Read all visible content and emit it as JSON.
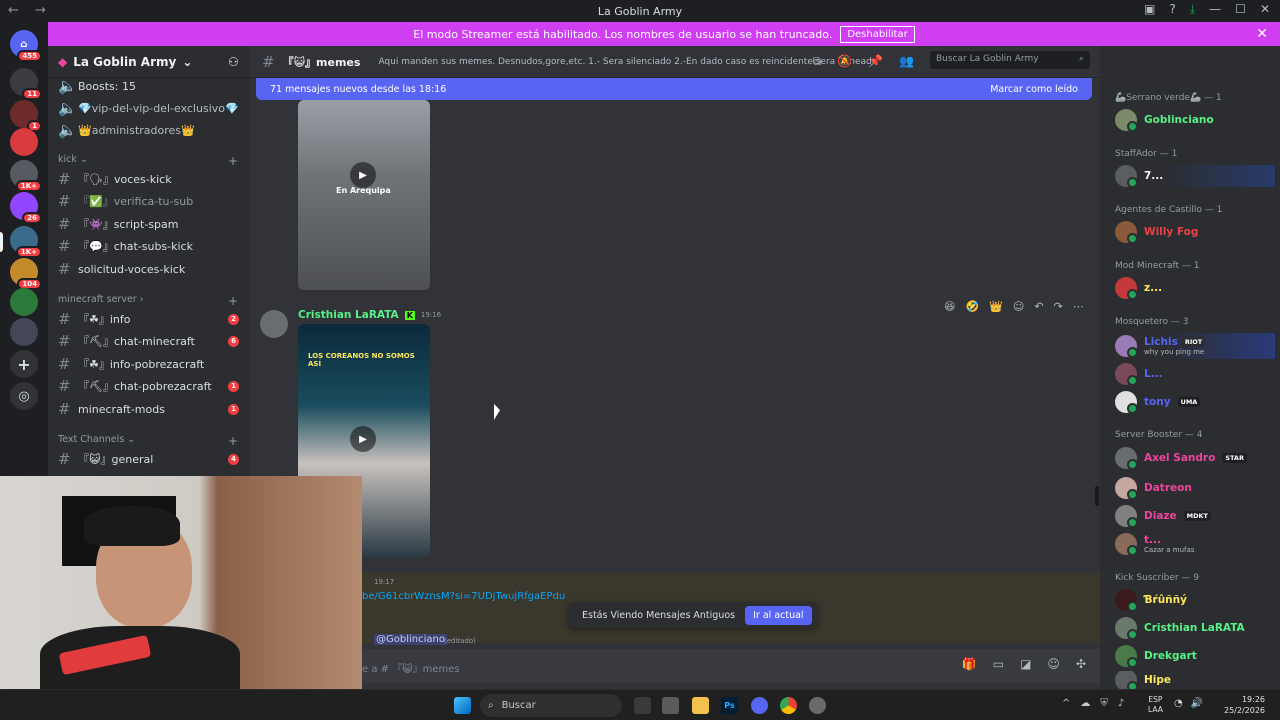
{
  "window": {
    "title": "La Goblin Army"
  },
  "banner": {
    "text": "El modo Streamer está habilitado. Los nombres de usuario se han truncado.",
    "button": "Deshabilitar"
  },
  "servers": [
    {
      "badge": "455",
      "color": "#5865f2"
    },
    {
      "badge": "11",
      "color": "#3a3c42"
    },
    {
      "badge": "1",
      "color": "#6e2b2b"
    },
    {
      "badge": "",
      "color": "#d83c3e"
    },
    {
      "badge": "1K+",
      "color": "#555a61"
    },
    {
      "badge": "26",
      "color": "#9146ff"
    },
    {
      "badge": "1K+",
      "color": "#3b6b8a"
    },
    {
      "badge": "104",
      "color": "#c48a2a"
    },
    {
      "badge": "",
      "color": "#2b7a3a"
    },
    {
      "badge": "",
      "color": "#44475a"
    }
  ],
  "sidebar": {
    "guild_name": "La Goblin Army",
    "boosts": "Boosts: 15",
    "voice_items": [
      "vip-del-vip-del-exclusivo",
      "administradores"
    ],
    "cat_kick": "kick",
    "kick_channels": [
      {
        "label": "『🗣』voces-kick",
        "badge": ""
      },
      {
        "label": "『✅』verifica-tu-sub",
        "badge": ""
      },
      {
        "label": "『👾』script-spam",
        "badge": ""
      },
      {
        "label": "『💬』chat-subs-kick",
        "badge": ""
      },
      {
        "label": "solicitud-voces-kick",
        "badge": ""
      }
    ],
    "cat_minecraft": "minecraft server",
    "mc_channels": [
      {
        "label": "『☘』info",
        "badge": "2"
      },
      {
        "label": "『⛏』chat-minecraft",
        "badge": "6"
      },
      {
        "label": "『☘』info-pobrezacraft",
        "badge": ""
      },
      {
        "label": "『⛏』chat-pobrezacraft",
        "badge": "1"
      },
      {
        "label": "minecraft-mods",
        "badge": "1"
      }
    ],
    "cat_text": "Text Channels",
    "text_channels": [
      {
        "label": "『😺』general",
        "badge": "4"
      }
    ]
  },
  "channel": {
    "name": "『😺』memes",
    "topic": "Aqui manden sus memes. Desnudos,gore,etc. 1.- Sera silenciado 2.-En dado caso es reincidente sera baneado",
    "search_placeholder": "Buscar La Goblin Army"
  },
  "newmsgs": {
    "text": "71 mensajes nuevos desde las 18:16",
    "mark": "Marcar como leído"
  },
  "messages": {
    "video1_caption": "En Arequipa",
    "author": "Cristhian LaRATA",
    "time": "19:16",
    "video2_caption": "LOS COREANOS NO SOMOS ASÍ",
    "link_time": "19:17",
    "link": "be/G61cbrWznsM?si=7UDjTwujRfgaEPdu",
    "mention": "@Goblinciano",
    "edited": "(editado)"
  },
  "old_messages": {
    "text": "Estás Viendo Mensajes Antiguos",
    "button": "Ir al actual"
  },
  "composer": {
    "placeholder": "e a # 『😺』memes"
  },
  "members": [
    {
      "group": "🦾Serrano verde🦾 — 1",
      "items": [
        {
          "name": "Goblinciano",
          "color": "#57f287",
          "sub": ""
        }
      ]
    },
    {
      "group": "StaffAdor — 1",
      "items": [
        {
          "name": "7...",
          "color": "#f2f3f5",
          "sub": ""
        }
      ]
    },
    {
      "group": "Agentes de Castillo — 1",
      "items": [
        {
          "name": "Willy Fog",
          "color": "#ed4245",
          "sub": ""
        }
      ]
    },
    {
      "group": "Mod Minecraft — 1",
      "items": [
        {
          "name": "z...",
          "color": "#fee75c",
          "sub": ""
        }
      ]
    },
    {
      "group": "Mosquetero — 3",
      "items": [
        {
          "name": "Lichis",
          "color": "#5865f2",
          "sub": "why you ping me"
        },
        {
          "name": "L...",
          "color": "#5865f2",
          "sub": ""
        },
        {
          "name": "tony",
          "color": "#5865f2",
          "sub": ""
        }
      ]
    },
    {
      "group": "Server Booster — 4",
      "items": [
        {
          "name": "Axel Sandro",
          "color": "#eb459e",
          "sub": ""
        },
        {
          "name": "Datreon",
          "color": "#eb459e",
          "sub": ""
        },
        {
          "name": "Diaze",
          "color": "#eb459e",
          "sub": ""
        },
        {
          "name": "t...",
          "color": "#eb459e",
          "sub": "Cazar a mufas"
        }
      ]
    },
    {
      "group": "Kick Suscriber — 9",
      "items": [
        {
          "name": "Ɓŕûññý",
          "color": "#fee75c",
          "sub": ""
        },
        {
          "name": "Cristhian LaRATA",
          "color": "#57f287",
          "sub": ""
        },
        {
          "name": "Drekgart",
          "color": "#57f287",
          "sub": ""
        },
        {
          "name": "Hipe",
          "color": "#fee75c",
          "sub": ""
        }
      ]
    }
  ],
  "tags": {
    "lichis": "RIOT",
    "tony": "UMA",
    "axel": "STAR",
    "diaze": "MDKT"
  },
  "taskbar": {
    "search": "Buscar",
    "lang": "ESP",
    "lang2": "LAA",
    "time": "19:26",
    "date": "25/2/2026"
  }
}
